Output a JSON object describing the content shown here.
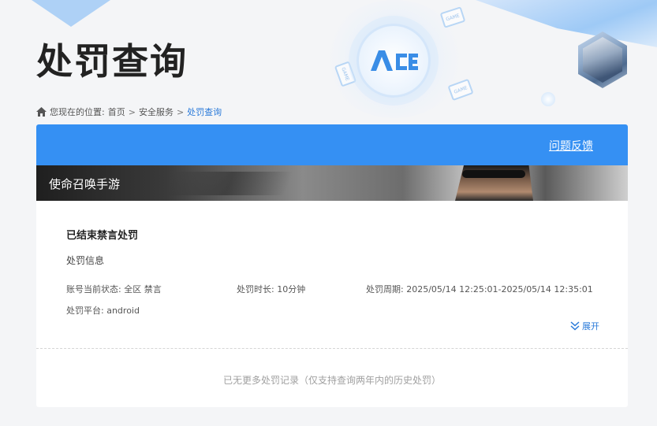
{
  "header": {
    "title": "处罚查询",
    "logo_text": "ACE"
  },
  "breadcrumb": {
    "prefix": "您现在的位置:",
    "home": "首页",
    "separator": ">",
    "section": "安全服务",
    "current": "处罚查询"
  },
  "card": {
    "feedback_label": "问题反馈",
    "game_name": "使命召唤手游"
  },
  "record": {
    "title": "已结束禁言处罚",
    "section_label": "处罚信息",
    "status_label": "账号当前状态:",
    "status_value": "全区 禁言",
    "duration_label": "处罚时长:",
    "duration_value": "10分钟",
    "period_label": "处罚周期:",
    "period_value": "2025/05/14 12:25:01-2025/05/14 12:35:01",
    "platform_label": "处罚平台:",
    "platform_value": "android",
    "expand_label": "展开"
  },
  "footer": {
    "note": "已无更多处罚记录（仅支持查询两年内的历史处罚）"
  },
  "colors": {
    "accent": "#3590f3",
    "link": "#2a7ad9"
  }
}
